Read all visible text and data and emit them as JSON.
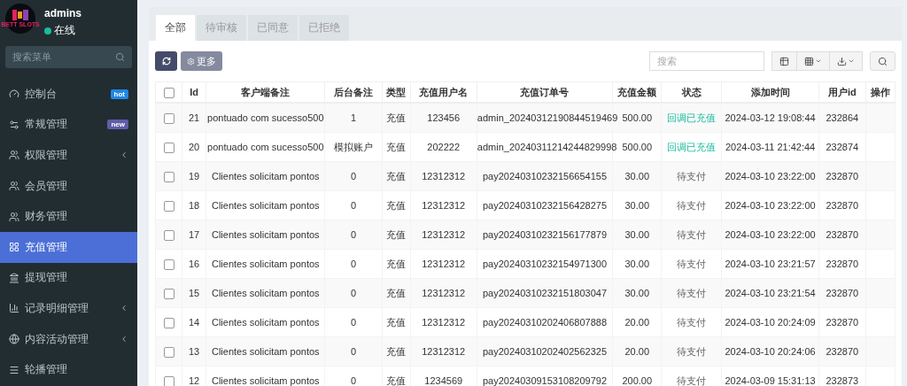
{
  "user": {
    "logo_text": "BETT SLOTS",
    "name": "admins",
    "status": "在线"
  },
  "sidebar": {
    "search": {
      "placeholder": "搜索菜单"
    },
    "items": [
      {
        "label": "控制台",
        "selected": false,
        "expandable": false,
        "badge": {
          "text": "hot",
          "color": "#1e88e5"
        }
      },
      {
        "label": "常规管理",
        "selected": false,
        "expandable": false,
        "badge": {
          "text": "new",
          "color": "#605ca8"
        }
      },
      {
        "label": "权限管理",
        "selected": false,
        "expandable": true
      },
      {
        "label": "会员管理",
        "selected": false,
        "expandable": false
      },
      {
        "label": "财务管理",
        "selected": false,
        "expandable": false
      },
      {
        "label": "充值管理",
        "selected": true,
        "expandable": false
      },
      {
        "label": "提现管理",
        "selected": false,
        "expandable": false
      },
      {
        "label": "记录明细管理",
        "selected": false,
        "expandable": true
      },
      {
        "label": "内容活动管理",
        "selected": false,
        "expandable": true
      },
      {
        "label": "轮播管理",
        "selected": false,
        "expandable": false
      }
    ]
  },
  "tabs": [
    {
      "label": "全部",
      "selected": true
    },
    {
      "label": "待审核",
      "selected": false
    },
    {
      "label": "已同意",
      "selected": false
    },
    {
      "label": "已拒绝",
      "selected": false
    }
  ],
  "toolbar": {
    "more_button": "更多",
    "search": {
      "placeholder": "搜索"
    }
  },
  "table": {
    "select_all_checked": false,
    "columns": [
      "Id",
      "客户端备注",
      "后台备注",
      "类型",
      "充值用户名",
      "充值订单号",
      "充值金额",
      "状态",
      "添加时间",
      "用户id",
      "操作"
    ],
    "rows": [
      {
        "checked": false,
        "cells": [
          "21",
          "pontuado com sucesso500",
          "1",
          "充值",
          "123456",
          "admin_20240312190844519469",
          "500.00"
        ],
        "status": {
          "text": "回调已充值",
          "kind": "success"
        },
        "time": "2024-03-12 19:08:44",
        "user_id": "232864"
      },
      {
        "checked": false,
        "cells": [
          "20",
          "pontuado com sucesso500",
          "模拟账户",
          "充值",
          "202222",
          "admin_20240311214244829998",
          "500.00"
        ],
        "status": {
          "text": "回调已充值",
          "kind": "success"
        },
        "time": "2024-03-11 21:42:44",
        "user_id": "232874"
      },
      {
        "checked": false,
        "cells": [
          "19",
          "Clientes solicitam pontos",
          "0",
          "充值",
          "12312312",
          "pay20240310232156654155",
          "30.00"
        ],
        "status": {
          "text": "待支付",
          "kind": "pending"
        },
        "time": "2024-03-10 23:22:00",
        "user_id": "232870"
      },
      {
        "checked": false,
        "cells": [
          "18",
          "Clientes solicitam pontos",
          "0",
          "充值",
          "12312312",
          "pay20240310232156428275",
          "30.00"
        ],
        "status": {
          "text": "待支付",
          "kind": "pending"
        },
        "time": "2024-03-10 23:22:00",
        "user_id": "232870"
      },
      {
        "checked": false,
        "cells": [
          "17",
          "Clientes solicitam pontos",
          "0",
          "充值",
          "12312312",
          "pay20240310232156177879",
          "30.00"
        ],
        "status": {
          "text": "待支付",
          "kind": "pending"
        },
        "time": "2024-03-10 23:22:00",
        "user_id": "232870"
      },
      {
        "checked": false,
        "cells": [
          "16",
          "Clientes solicitam pontos",
          "0",
          "充值",
          "12312312",
          "pay20240310232154971300",
          "30.00"
        ],
        "status": {
          "text": "待支付",
          "kind": "pending"
        },
        "time": "2024-03-10 23:21:57",
        "user_id": "232870"
      },
      {
        "checked": false,
        "cells": [
          "15",
          "Clientes solicitam pontos",
          "0",
          "充值",
          "12312312",
          "pay20240310232151803047",
          "30.00"
        ],
        "status": {
          "text": "待支付",
          "kind": "pending"
        },
        "time": "2024-03-10 23:21:54",
        "user_id": "232870"
      },
      {
        "checked": false,
        "cells": [
          "14",
          "Clientes solicitam pontos",
          "0",
          "充值",
          "12312312",
          "pay20240310202406807888",
          "20.00"
        ],
        "status": {
          "text": "待支付",
          "kind": "pending"
        },
        "time": "2024-03-10 20:24:09",
        "user_id": "232870"
      },
      {
        "checked": false,
        "cells": [
          "13",
          "Clientes solicitam pontos",
          "0",
          "充值",
          "12312312",
          "pay20240310202402562325",
          "20.00"
        ],
        "status": {
          "text": "待支付",
          "kind": "pending"
        },
        "time": "2024-03-10 20:24:06",
        "user_id": "232870"
      },
      {
        "checked": false,
        "cells": [
          "12",
          "Clientes solicitam pontos",
          "0",
          "充值",
          "1234569",
          "pay20240309153108209792",
          "200.00"
        ],
        "status": {
          "text": "待支付",
          "kind": "pending"
        },
        "time": "2024-03-09 15:31:13",
        "user_id": "232873"
      }
    ]
  }
}
